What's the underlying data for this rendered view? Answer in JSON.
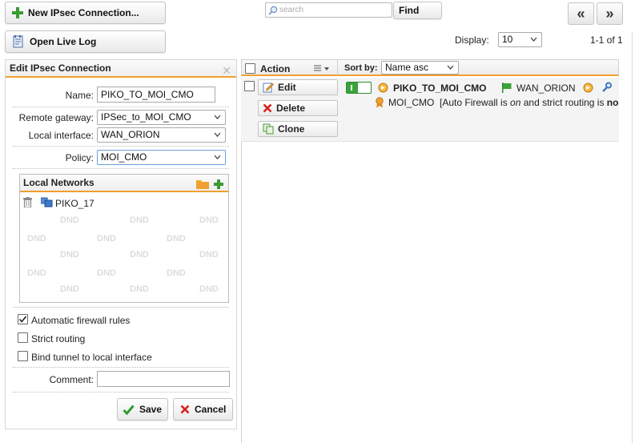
{
  "toolbar": {
    "new_connection": "New IPsec Connection...",
    "open_log": "Open Live Log",
    "search_placeholder": "search",
    "find": "Find",
    "prev_page": "«",
    "next_page": "»"
  },
  "display": {
    "label": "Display:",
    "value": "10",
    "range": "1-1 of 1"
  },
  "edit_panel": {
    "title": "Edit IPsec Connection",
    "name_label": "Name:",
    "name_value": "PIKO_TO_MOI_CMO",
    "remote_gateway_label": "Remote gateway:",
    "remote_gateway_value": "IPSec_to_MOI_CMO",
    "local_interface_label": "Local interface:",
    "local_interface_value": "WAN_ORION",
    "policy_label": "Policy:",
    "policy_value": "MOI_CMO",
    "local_networks_title": "Local Networks",
    "local_networks": [
      "PIKO_17"
    ],
    "dnd": "DND",
    "auto_fw_label": "Automatic firewall rules",
    "auto_fw_checked": true,
    "strict_label": "Strict routing",
    "strict_checked": false,
    "bind_label": "Bind tunnel to local interface",
    "bind_checked": false,
    "comment_label": "Comment:",
    "comment_value": "",
    "save": "Save",
    "cancel": "Cancel"
  },
  "list": {
    "action_header": "Action",
    "sort_label": "Sort by:",
    "sort_value": "Name asc",
    "actions": {
      "edit": "Edit",
      "delete": "Delete",
      "clone": "Clone"
    },
    "item": {
      "name": "PIKO_TO_MOI_CMO",
      "interface": "WAN_ORION",
      "policy": "MOI_CMO",
      "info_prefix": "[Auto Firewall is ",
      "info_on": "on",
      "info_mid": " and strict routing is ",
      "info_tail": "no"
    }
  },
  "colors": {
    "accent": "#f0a030",
    "toggle_on": "#3aa33a",
    "delete_red": "#d6211f",
    "save_green": "#2e9b2e"
  }
}
